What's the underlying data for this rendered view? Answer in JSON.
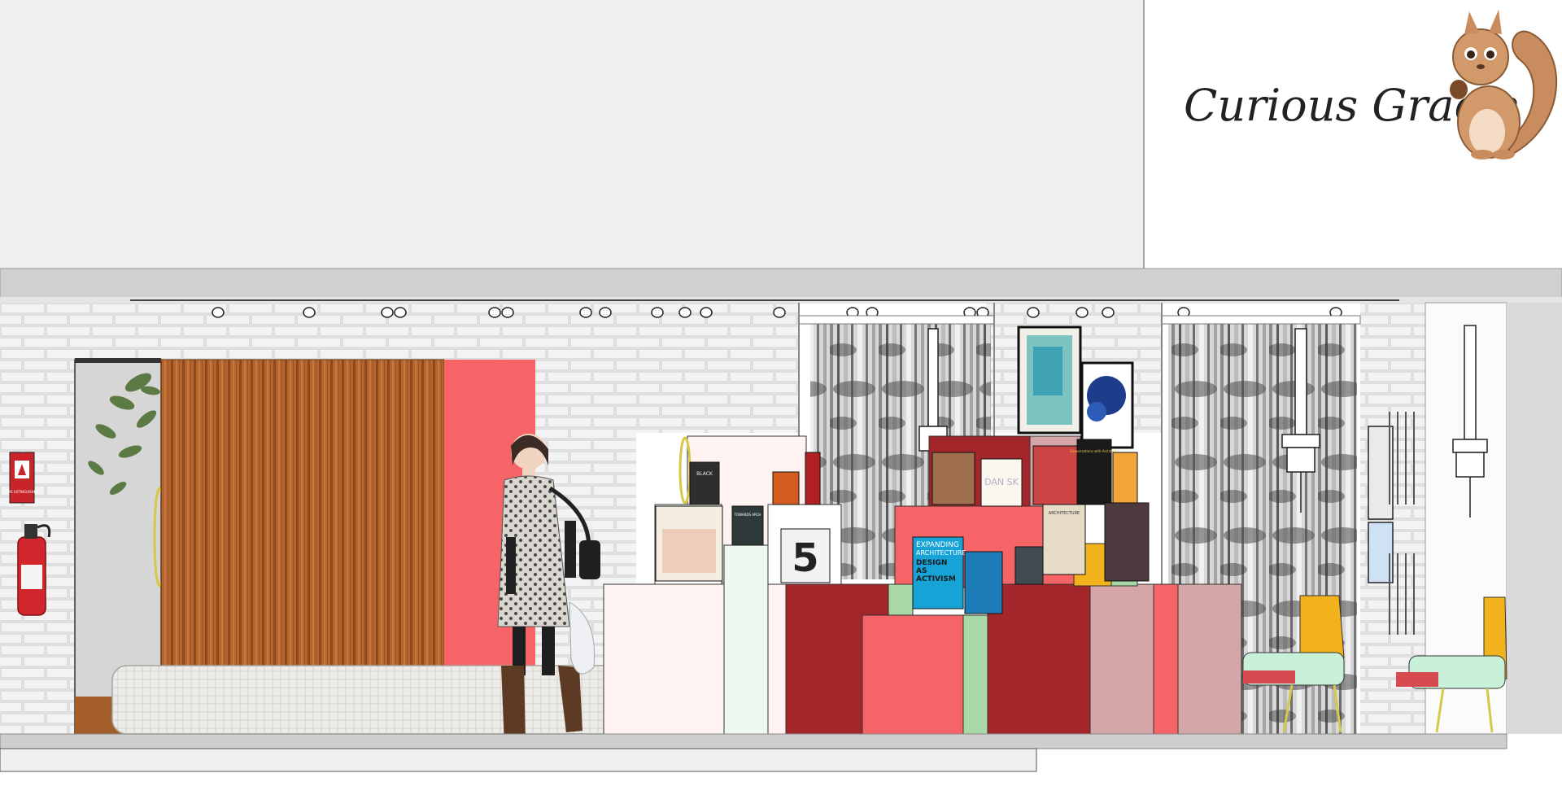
{
  "brand": {
    "name": "Curious Gracie",
    "mascot_icon": "squirrel-icon"
  },
  "signage": {
    "fire_sign_text": "FIRE EXTINGUISHER"
  },
  "books": {
    "black_cover": "BLACK",
    "lined_cover": "TOWARDS ARCH",
    "cover_5": "5",
    "blue_cover_lines": [
      "EXPANDING",
      "ARCHITECTURE",
      "DESIGN",
      "AS",
      "ACTIVISM"
    ],
    "dan_cover": "DAN SK",
    "black_tall_cover": "Conversations with Architects",
    "arch_cover": "ARCHITECTURE"
  },
  "colors": {
    "wall_grey": "#efefef",
    "tile_white": "#f7f7f7",
    "coral": "#f76467",
    "crimson": "#a3262b",
    "blush": "#d4a6a8",
    "mint": "#a8d8a6",
    "timber": "#b5652d",
    "mustard": "#f2b21c"
  }
}
